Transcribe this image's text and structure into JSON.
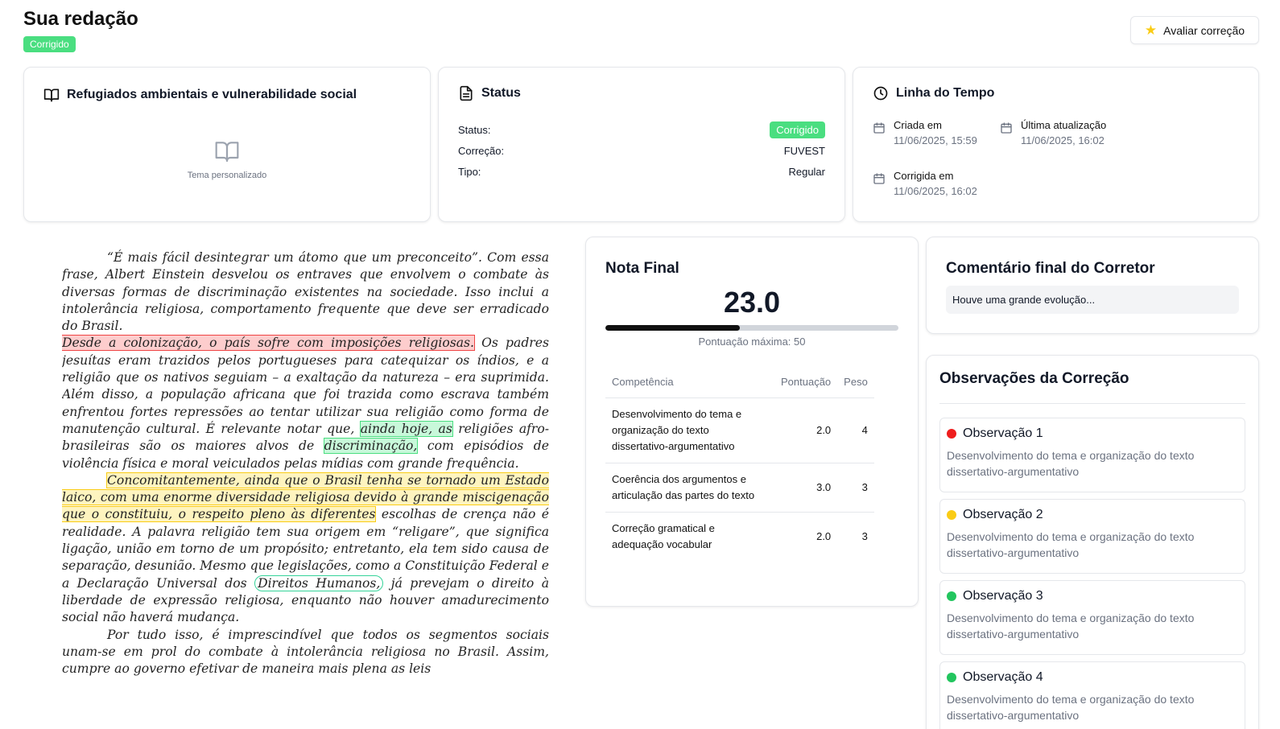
{
  "header": {
    "title": "Sua redação",
    "status_badge": "Corrigido",
    "rate_button": "Avaliar correção",
    "rate_icon": "star-icon"
  },
  "theme_card": {
    "title": "Refugiados ambientais e vulnerabilidade social",
    "placeholder": "Tema personalizado",
    "icon": "book-icon"
  },
  "status_card": {
    "title": "Status",
    "rows": [
      {
        "label": "Status:",
        "value": "Corrigido"
      },
      {
        "label": "Correção:",
        "value": "FUVEST"
      },
      {
        "label": "Tipo:",
        "value": "Regular"
      }
    ]
  },
  "timeline_card": {
    "title": "Linha do Tempo",
    "items": [
      {
        "label": "Criada em",
        "date": "11/06/2025, 15:59"
      },
      {
        "label": "Última atualização",
        "date": "11/06/2025, 16:02"
      },
      {
        "label": "Corrigida em",
        "date": "11/06/2025, 16:02"
      }
    ]
  },
  "essay": {
    "p1": "“É mais fácil desintegrar um átomo que um preconceito”. Com essa frase, Albert Einstein desvelou os entraves que envolvem o combate às diversas formas de discriminação existentes na sociedade. Isso inclui a intolerância religiosa, comportamento frequente que deve ser erradicado do Brasil.",
    "p2_highlight": "Desde a colonização, o país sofre com imposições religiosas.",
    "p2_a": " Os padres jesuítas eram trazidos pelos portugueses para catequizar os índios, e a religião que os nativos seguiam – a exaltação da natureza – era suprimida. Além disso, a população africana que foi trazida como escrava também enfrentou fortes repressões ao tentar utilizar sua religião como forma de manutenção cultural. É relevante notar que, ",
    "p2_green1": "ainda hoje, as",
    "p2_b": " religiões afro-brasileiras são os maiores alvos de ",
    "p2_green2": "discriminação,",
    "p2_c": " com episódios de violência física e moral veiculados pelas mídias com grande frequência.",
    "p3_highlight": "Concomitantemente, ainda que o Brasil tenha se tornado um Estado laico, com uma enorme diversidade religiosa devido à grande miscigenação que o constituiu, o respeito pleno às diferentes",
    "p3_a": " escolhas de crença não é realidade. A palavra religião tem sua origem em “religare”, que significa ligação, união em torno de um propósito; entretanto, ela tem sido causa de separação, desunião. Mesmo que legislações, como a Constituição Federal e a Declaração Universal dos ",
    "p3_oval": "Direitos Humanos,",
    "p3_b": " já prevejam o direito à liberdade de expressão religiosa, enquanto não houver amadurecimento social não haverá mudança.",
    "p4": "Por tudo isso, é imprescindível que todos os segmentos sociais unam-se em prol do combate à intolerância religiosa no Brasil. Assim, cumpre ao governo efetivar de maneira mais plena as leis"
  },
  "score_card": {
    "title": "Nota Final",
    "score": "23.0",
    "progress": 0.46,
    "max_label": "Pontuação máxima: 50",
    "columns": [
      "Competência",
      "Pontuação",
      "Peso"
    ],
    "rows": [
      {
        "competencia": "Desenvolvimento do tema e organização do texto dissertativo-argumentativo",
        "pontuacao": "2.0",
        "peso": "4"
      },
      {
        "competencia": "Coerência dos argumentos e articulação das partes do texto",
        "pontuacao": "3.0",
        "peso": "3"
      },
      {
        "competencia": "Correção gramatical e adequação vocabular",
        "pontuacao": "2.0",
        "peso": "3"
      }
    ]
  },
  "comment_card": {
    "title": "Comentário final do Corretor",
    "comment": "Houve uma grande evolução..."
  },
  "observations": {
    "title": "Observações da Correção",
    "items": [
      {
        "title": "Observação 1",
        "desc": "Desenvolvimento do tema e organização do texto dissertativo-argumentativo",
        "color": "#ef1d1d"
      },
      {
        "title": "Observação 2",
        "desc": "Desenvolvimento do tema e organização do texto dissertativo-argumentativo",
        "color": "#facc15"
      },
      {
        "title": "Observação 3",
        "desc": "Desenvolvimento do tema e organização do texto dissertativo-argumentativo",
        "color": "#22c55e"
      },
      {
        "title": "Observação 4",
        "desc": "Desenvolvimento do tema e organização do texto dissertativo-argumentativo",
        "color": "#22c55e"
      }
    ]
  }
}
